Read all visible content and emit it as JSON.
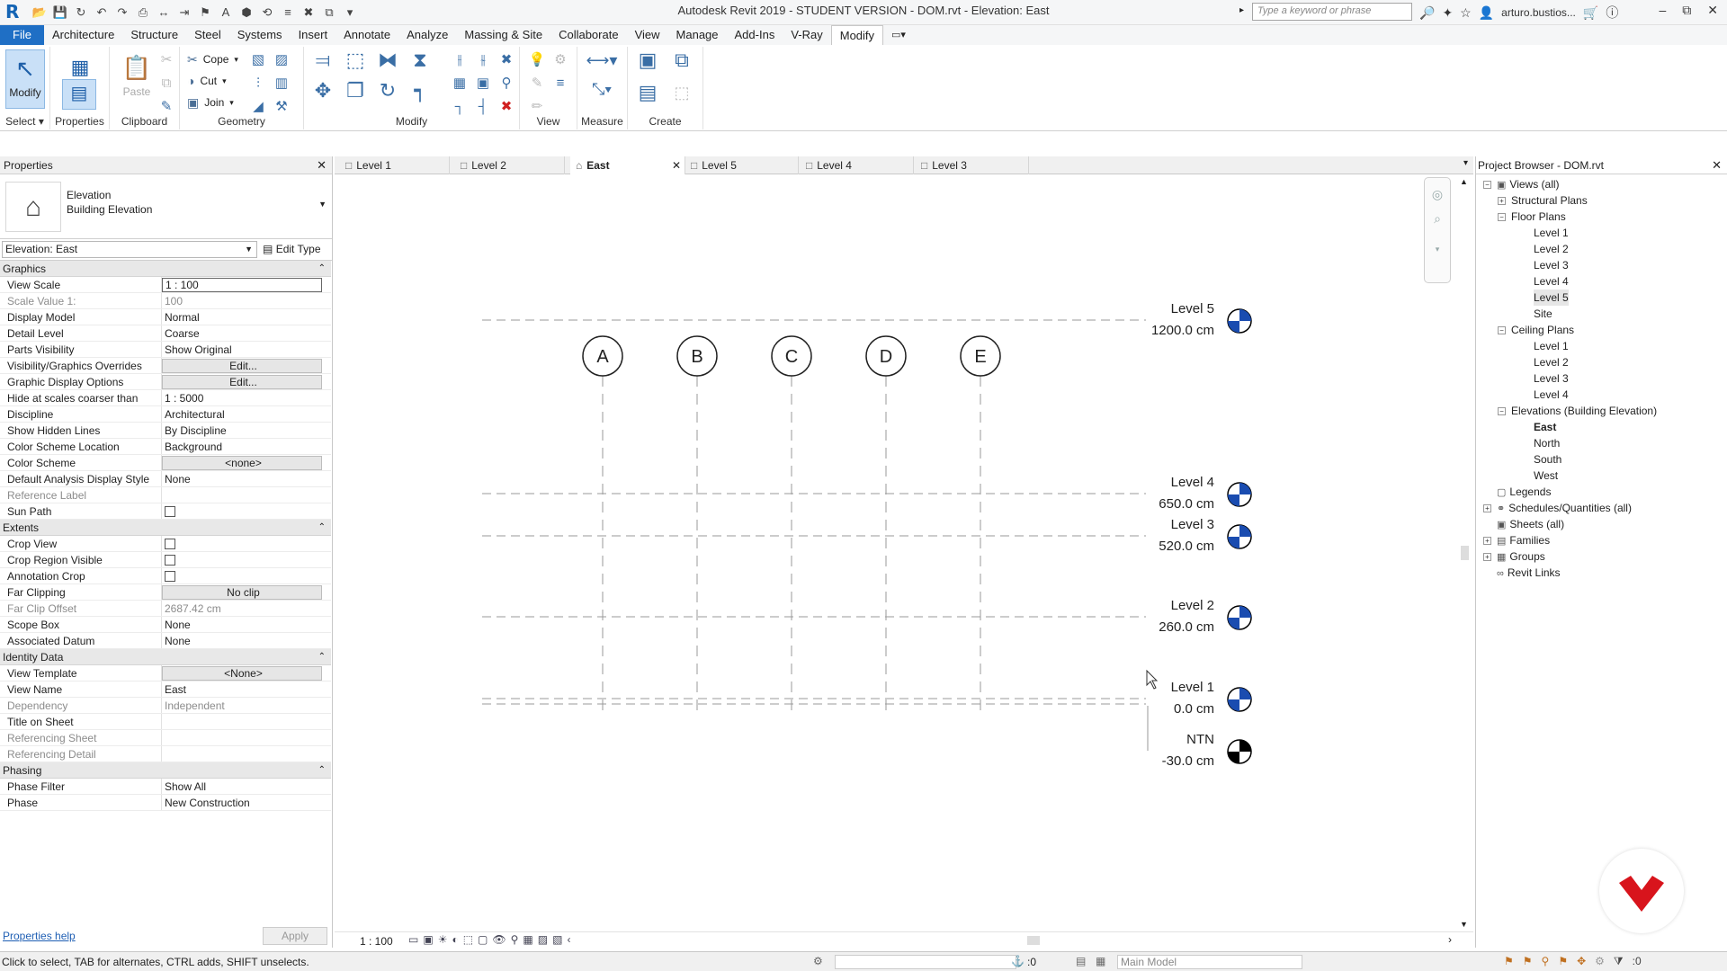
{
  "app": {
    "title": "Autodesk Revit 2019 - STUDENT VERSION - DOM.rvt - Elevation: East",
    "search_placeholder": "Type a keyword or phrase",
    "user": "arturo.bustios...",
    "logo_letter": "R"
  },
  "menu": {
    "tabs": [
      "File",
      "Architecture",
      "Structure",
      "Steel",
      "Systems",
      "Insert",
      "Annotate",
      "Analyze",
      "Massing & Site",
      "Collaborate",
      "View",
      "Manage",
      "Add-Ins",
      "V-Ray",
      "Modify"
    ],
    "active": "Modify"
  },
  "ribbon": {
    "select": {
      "modify_label": "Modify",
      "panel": "Select"
    },
    "properties": {
      "label": "Properties"
    },
    "clipboard": {
      "paste_label": "Paste",
      "panel": "Clipboard"
    },
    "geometry": {
      "cope": "Cope",
      "cut": "Cut",
      "join": "Join",
      "panel": "Geometry"
    },
    "modify_panel": "Modify",
    "view_panel": "View",
    "measure_panel": "Measure",
    "create_panel": "Create"
  },
  "properties": {
    "header": "Properties",
    "type_family": "Elevation",
    "type_name": "Building Elevation",
    "instance_selector": "Elevation: East",
    "edit_type": "Edit Type",
    "groups": [
      {
        "name": "Graphics",
        "rows": [
          {
            "k": "View Scale",
            "v": "1 : 100",
            "kind": "field"
          },
          {
            "k": "Scale Value    1:",
            "v": "100",
            "kind": "ro"
          },
          {
            "k": "Display Model",
            "v": "Normal"
          },
          {
            "k": "Detail Level",
            "v": "Coarse"
          },
          {
            "k": "Parts Visibility",
            "v": "Show Original"
          },
          {
            "k": "Visibility/Graphics Overrides",
            "v": "Edit...",
            "kind": "btn"
          },
          {
            "k": "Graphic Display Options",
            "v": "Edit...",
            "kind": "btn"
          },
          {
            "k": "Hide at scales coarser than",
            "v": "1 : 5000"
          },
          {
            "k": "Discipline",
            "v": "Architectural"
          },
          {
            "k": "Show Hidden Lines",
            "v": "By Discipline"
          },
          {
            "k": "Color Scheme Location",
            "v": "Background"
          },
          {
            "k": "Color Scheme",
            "v": "<none>",
            "kind": "btn"
          },
          {
            "k": "Default Analysis Display Style",
            "v": "None"
          },
          {
            "k": "Reference Label",
            "v": "",
            "kind": "ro"
          },
          {
            "k": "Sun Path",
            "v": "",
            "kind": "cb"
          }
        ]
      },
      {
        "name": "Extents",
        "rows": [
          {
            "k": "Crop View",
            "v": "",
            "kind": "cb"
          },
          {
            "k": "Crop Region Visible",
            "v": "",
            "kind": "cb"
          },
          {
            "k": "Annotation Crop",
            "v": "",
            "kind": "cb"
          },
          {
            "k": "Far Clipping",
            "v": "No clip",
            "kind": "btn"
          },
          {
            "k": "Far Clip Offset",
            "v": "2687.42 cm",
            "kind": "ro"
          },
          {
            "k": "Scope Box",
            "v": "None"
          },
          {
            "k": "Associated Datum",
            "v": "None"
          }
        ]
      },
      {
        "name": "Identity Data",
        "rows": [
          {
            "k": "View Template",
            "v": "<None>",
            "kind": "btn"
          },
          {
            "k": "View Name",
            "v": "East"
          },
          {
            "k": "Dependency",
            "v": "Independent",
            "kind": "ro"
          },
          {
            "k": "Title on Sheet",
            "v": ""
          },
          {
            "k": "Referencing Sheet",
            "v": "",
            "kind": "ro"
          },
          {
            "k": "Referencing Detail",
            "v": "",
            "kind": "ro"
          }
        ]
      },
      {
        "name": "Phasing",
        "rows": [
          {
            "k": "Phase Filter",
            "v": "Show All"
          },
          {
            "k": "Phase",
            "v": "New Construction"
          }
        ]
      }
    ],
    "help_link": "Properties help",
    "apply": "Apply"
  },
  "view_tabs": [
    {
      "label": "Level 1",
      "icon": "floor-plan"
    },
    {
      "label": "Level 2",
      "icon": "floor-plan"
    },
    {
      "label": "East",
      "icon": "elevation",
      "active": true
    },
    {
      "label": "Level 5",
      "icon": "floor-plan"
    },
    {
      "label": "Level 4",
      "icon": "floor-plan"
    },
    {
      "label": "Level 3",
      "icon": "floor-plan"
    }
  ],
  "drawing": {
    "grids": [
      "A",
      "B",
      "C",
      "D",
      "E"
    ],
    "levels": [
      {
        "name": "Level 5",
        "elev": "1200.0 cm"
      },
      {
        "name": "Level 4",
        "elev": "650.0 cm"
      },
      {
        "name": "Level 3",
        "elev": "520.0 cm"
      },
      {
        "name": "Level 2",
        "elev": "260.0 cm"
      },
      {
        "name": "Level 1",
        "elev": "0.0 cm"
      },
      {
        "name": "NTN",
        "elev": "-30.0 cm"
      }
    ],
    "view_scale": "1 : 100"
  },
  "browser": {
    "header": "Project Browser - DOM.rvt",
    "nodes": [
      {
        "label": "Views (all)",
        "depth": 0,
        "exp": "-"
      },
      {
        "label": "Structural Plans",
        "depth": 1,
        "exp": "+"
      },
      {
        "label": "Floor Plans",
        "depth": 1,
        "exp": "-"
      },
      {
        "label": "Level 1",
        "depth": 2
      },
      {
        "label": "Level 2",
        "depth": 2
      },
      {
        "label": "Level 3",
        "depth": 2
      },
      {
        "label": "Level 4",
        "depth": 2
      },
      {
        "label": "Level 5",
        "depth": 2,
        "selected": true
      },
      {
        "label": "Site",
        "depth": 2
      },
      {
        "label": "Ceiling Plans",
        "depth": 1,
        "exp": "-"
      },
      {
        "label": "Level 1",
        "depth": 2
      },
      {
        "label": "Level 2",
        "depth": 2
      },
      {
        "label": "Level 3",
        "depth": 2
      },
      {
        "label": "Level 4",
        "depth": 2
      },
      {
        "label": "Elevations (Building Elevation)",
        "depth": 1,
        "exp": "-"
      },
      {
        "label": "East",
        "depth": 2,
        "bold": true
      },
      {
        "label": "North",
        "depth": 2
      },
      {
        "label": "South",
        "depth": 2
      },
      {
        "label": "West",
        "depth": 2
      },
      {
        "label": "Legends",
        "depth": 0,
        "exp": ""
      },
      {
        "label": "Schedules/Quantities (all)",
        "depth": 0,
        "exp": "+"
      },
      {
        "label": "Sheets (all)",
        "depth": 0,
        "exp": ""
      },
      {
        "label": "Families",
        "depth": 0,
        "exp": "+"
      },
      {
        "label": "Groups",
        "depth": 0,
        "exp": "+"
      },
      {
        "label": "Revit Links",
        "depth": 0,
        "exp": ""
      }
    ]
  },
  "status": {
    "text": "Click to select, TAB for alternates, CTRL adds, SHIFT unselects.",
    "zero": ":0",
    "model": "Main Model"
  },
  "colors": {
    "accent": "#1f6fc5",
    "level_marker_blue": "#1a4cb0",
    "brand_red": "#d8141c"
  }
}
